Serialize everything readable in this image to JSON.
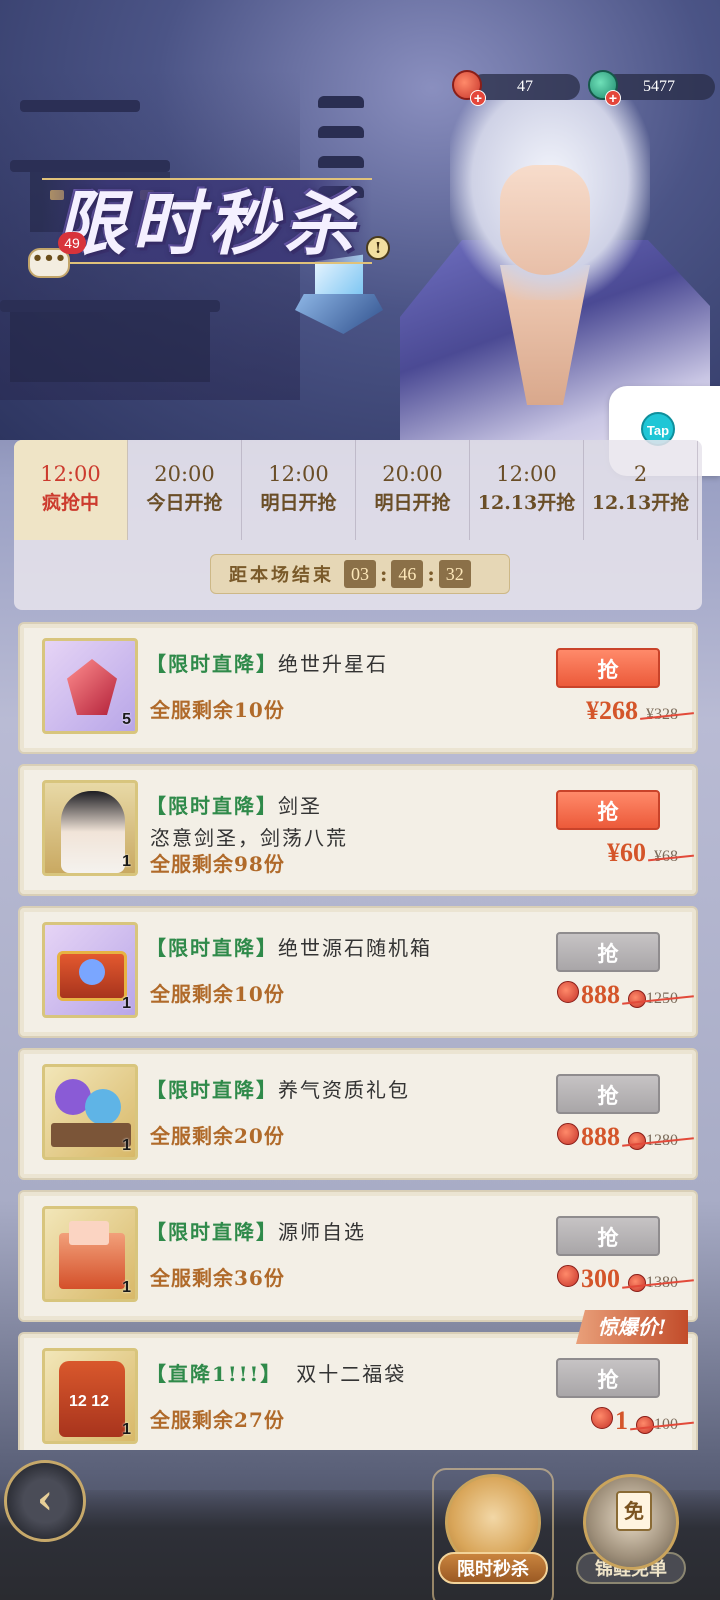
{
  "header": {
    "title": "限时秒杀",
    "chat_badge": "49",
    "chat_icon_text": "•••",
    "info_icon_text": "!"
  },
  "currency": {
    "red_gem": "47",
    "green_gem": "5477"
  },
  "tap_button": "Tap",
  "tabs": [
    {
      "time": "12:00",
      "status": "疯抢中"
    },
    {
      "time": "20:00",
      "status": "今日开抢"
    },
    {
      "time": "12:00",
      "status": "明日开抢"
    },
    {
      "time": "20:00",
      "status": "明日开抢"
    },
    {
      "time": "12:00",
      "status": "12.13开抢"
    },
    {
      "time": "2",
      "status": "12.13开抢"
    }
  ],
  "countdown": {
    "label": "距本场结束",
    "hours": "03",
    "minutes": "46",
    "seconds": "32"
  },
  "items": [
    {
      "tag": "【限时直降】",
      "name": "绝世升星石",
      "desc": "",
      "stock": "全服剩余10份",
      "qty": "5",
      "buy": "抢",
      "price": "¥268",
      "old_price": "¥328",
      "currency": "rmb",
      "available": true
    },
    {
      "tag": "【限时直降】",
      "name": "剑圣",
      "desc": "恣意剑圣，剑荡八荒",
      "stock": "全服剩余98份",
      "qty": "1",
      "buy": "抢",
      "price": "¥60",
      "old_price": "¥68",
      "currency": "rmb",
      "available": true
    },
    {
      "tag": "【限时直降】",
      "name": "绝世源石随机箱",
      "desc": "",
      "stock": "全服剩余10份",
      "qty": "1",
      "buy": "抢",
      "price": "888",
      "old_price": "1250",
      "currency": "gem",
      "available": false
    },
    {
      "tag": "【限时直降】",
      "name": "养气资质礼包",
      "desc": "",
      "stock": "全服剩余20份",
      "qty": "1",
      "buy": "抢",
      "price": "888",
      "old_price": "1280",
      "currency": "gem",
      "available": false
    },
    {
      "tag": "【限时直降】",
      "name": "源师自选",
      "desc": "",
      "stock": "全服剩余36份",
      "qty": "1",
      "buy": "抢",
      "price": "300",
      "old_price": "1380",
      "currency": "gem",
      "available": false
    },
    {
      "tag": "【直降1!!!】",
      "name": "双十二福袋",
      "desc": "",
      "stock": "全服剩余27份",
      "qty": "1",
      "buy": "抢",
      "price": "1",
      "old_price": "100",
      "currency": "gem",
      "available": false
    }
  ],
  "hot_tag": "惊爆价!",
  "bottom_nav": {
    "back_icon": "back-icon",
    "tab1_label": "限时秒杀",
    "tab2_label": "锦鲤免单",
    "tab2_badge_char": "免"
  },
  "colors": {
    "accent_red": "#ec5a3a",
    "green_tag": "#2f8a4a",
    "price_orange": "#d4552a"
  }
}
